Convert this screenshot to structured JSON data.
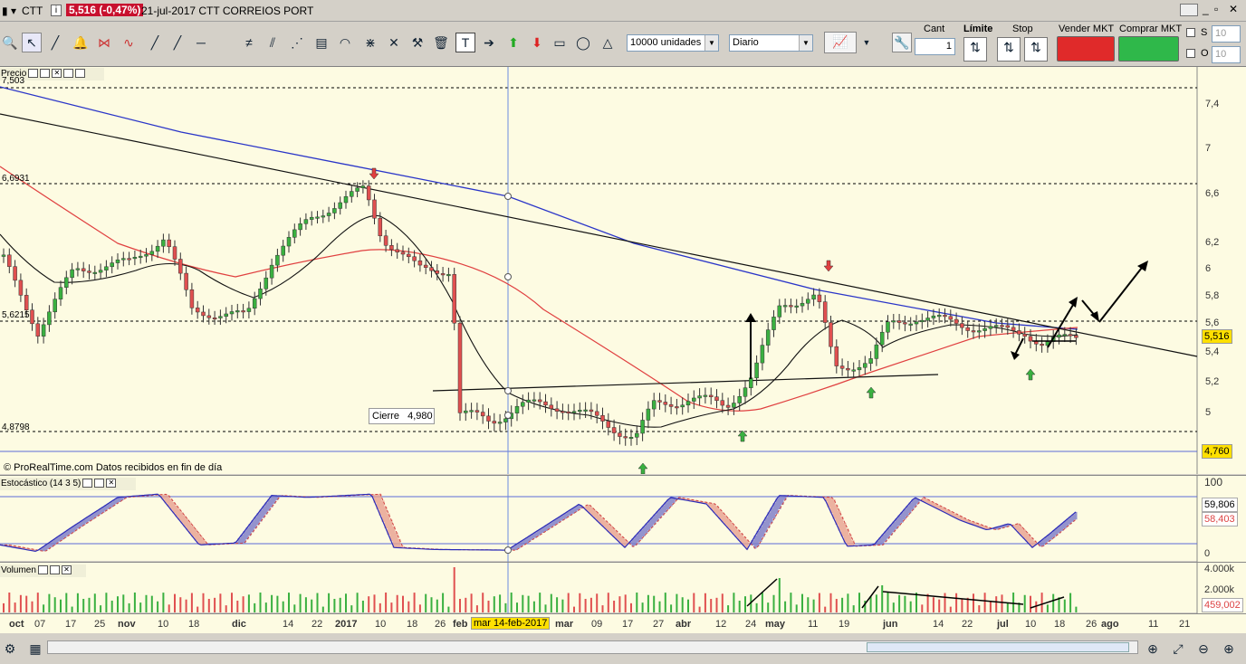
{
  "title": {
    "symbol": "CTT",
    "price_badge": "5,516 (-0,47%)",
    "date_name": "21-jul-2017 CTT CORREIOS PORT"
  },
  "toolbar": {
    "units": "10000 unidades",
    "period": "Diario",
    "cant_label": "Cant",
    "cant_value": "1",
    "limite_label": "Límite",
    "stop_label": "Stop",
    "sell_label": "Vender MKT",
    "buy_label": "Comprar MKT",
    "s_label": "S",
    "o_label": "O",
    "s_value": "10",
    "o_value": "10"
  },
  "price_panel": {
    "title": "Precio",
    "footer": "© ProRealTime.com  Datos recibidos en fin de día",
    "tooltip_label": "Cierre",
    "tooltip_value": "4,980",
    "hline_labels": [
      "7,503",
      "6,6931",
      "5,6215",
      "4,8798"
    ],
    "last_price": "5,516",
    "low_mark": "4,760"
  },
  "stoch_panel": {
    "title": "Estocástico (14 3 5)",
    "v1": "59,806",
    "v2": "58,403",
    "top": "100",
    "bottom": "0"
  },
  "vol_panel": {
    "title": "Volumen",
    "ticks": [
      "4.000k",
      "2.000k"
    ],
    "last": "459,002"
  },
  "xaxis": {
    "labels": [
      "oct",
      "07",
      "17",
      "25",
      "nov",
      "10",
      "18",
      "dic",
      "14",
      "22",
      "2017",
      "10",
      "18",
      "26",
      "feb",
      "mar",
      "09",
      "17",
      "27",
      "abr",
      "12",
      "24",
      "may",
      "11",
      "19",
      "jun",
      "14",
      "22",
      "jul",
      "10",
      "18",
      "26",
      "ago",
      "11",
      "21"
    ],
    "cursor_date": "mar 14-feb-2017"
  },
  "chart_data": {
    "type": "candlestick",
    "title": "CTT",
    "yticks": [
      "7,4",
      "7",
      "6,6",
      "6,2",
      "6",
      "5,8",
      "5,6",
      "5,4",
      "5,2",
      "5"
    ],
    "ylim": [
      4.7,
      7.6
    ],
    "price_points": [
      [
        0,
        6.1
      ],
      [
        40,
        5.55
      ],
      [
        80,
        6.0
      ],
      [
        140,
        6.05
      ],
      [
        180,
        6.25
      ],
      [
        210,
        5.7
      ],
      [
        270,
        5.65
      ],
      [
        300,
        6.1
      ],
      [
        340,
        6.4
      ],
      [
        400,
        6.65
      ],
      [
        420,
        6.25
      ],
      [
        460,
        6.0
      ],
      [
        495,
        6.0
      ],
      [
        500,
        5.6
      ],
      [
        505,
        5.0
      ],
      [
        540,
        4.95
      ],
      [
        570,
        5.05
      ],
      [
        620,
        5.05
      ],
      [
        660,
        4.95
      ],
      [
        700,
        4.85
      ],
      [
        720,
        5.05
      ],
      [
        760,
        5.1
      ],
      [
        800,
        5.05
      ],
      [
        830,
        5.25
      ],
      [
        860,
        5.75
      ],
      [
        900,
        5.8
      ],
      [
        920,
        5.3
      ],
      [
        960,
        5.35
      ],
      [
        980,
        5.6
      ],
      [
        1010,
        5.65
      ],
      [
        1060,
        5.6
      ],
      [
        1100,
        5.55
      ],
      [
        1130,
        5.55
      ],
      [
        1150,
        5.45
      ],
      [
        1185,
        5.52
      ]
    ],
    "stoch_points": [
      [
        0,
        12
      ],
      [
        40,
        2
      ],
      [
        80,
        40
      ],
      [
        130,
        85
      ],
      [
        175,
        90
      ],
      [
        220,
        12
      ],
      [
        260,
        15
      ],
      [
        300,
        88
      ],
      [
        340,
        85
      ],
      [
        410,
        90
      ],
      [
        435,
        8
      ],
      [
        480,
        5
      ],
      [
        560,
        4
      ],
      [
        640,
        75
      ],
      [
        690,
        8
      ],
      [
        740,
        85
      ],
      [
        780,
        75
      ],
      [
        825,
        5
      ],
      [
        860,
        88
      ],
      [
        910,
        85
      ],
      [
        935,
        10
      ],
      [
        965,
        12
      ],
      [
        1010,
        85
      ],
      [
        1060,
        50
      ],
      [
        1090,
        35
      ],
      [
        1115,
        45
      ],
      [
        1140,
        8
      ],
      [
        1160,
        30
      ],
      [
        1190,
        65
      ]
    ]
  }
}
